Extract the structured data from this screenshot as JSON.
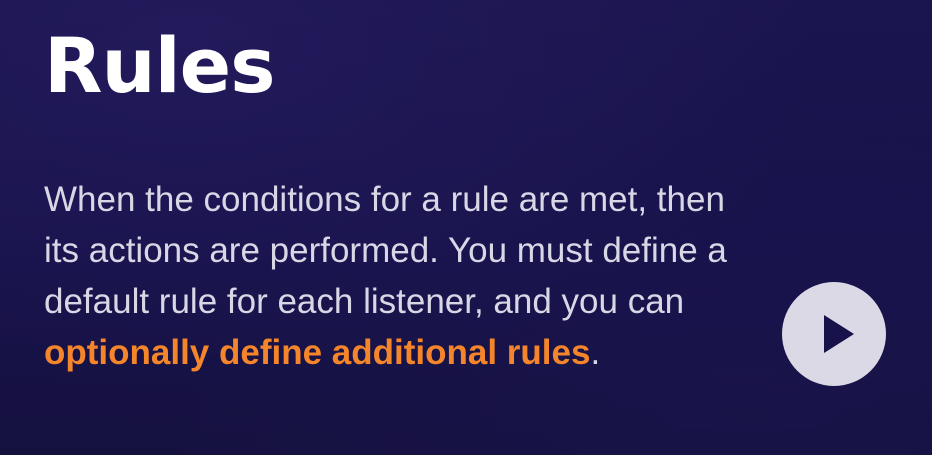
{
  "slide": {
    "title": "Rules",
    "body_lines": [
      "When the conditions for a rule are met, then",
      "its actions are performed. You must define a",
      "default rule for each listener, and you can"
    ],
    "highlight": "optionally define additional rules",
    "trailing": ".",
    "colors": {
      "background": "#17124a",
      "title": "#ffffff",
      "body": "#d8d7e6",
      "highlight": "#f5852a",
      "play_button": "#dcd9e6",
      "play_icon": "#17124a"
    }
  },
  "player": {
    "play_icon": "play-icon"
  }
}
